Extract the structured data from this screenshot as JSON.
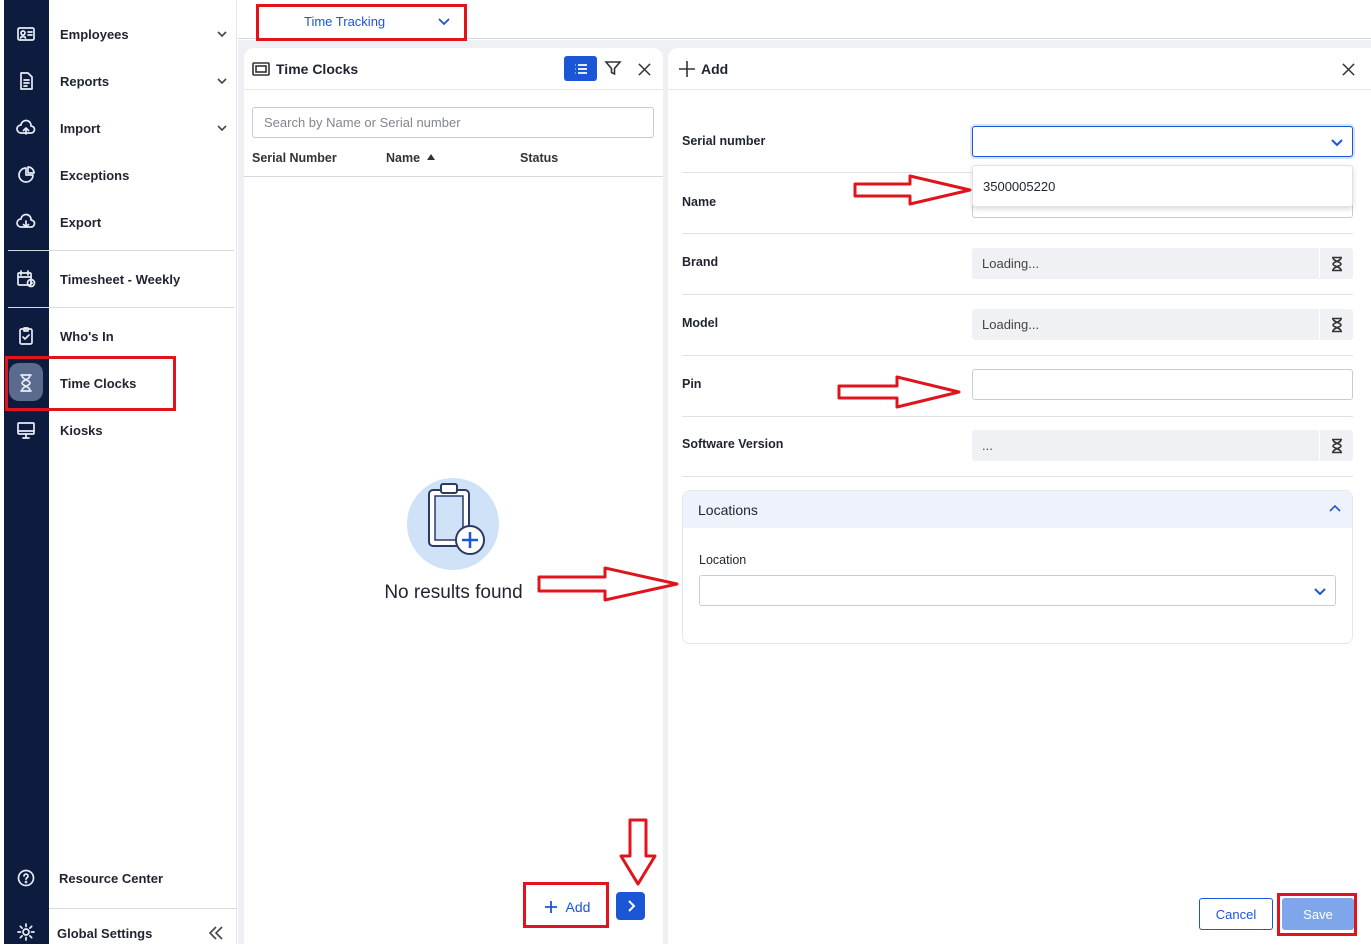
{
  "module": {
    "label": "Time Tracking"
  },
  "nav": {
    "items": [
      {
        "label": "Employees",
        "icon": "id-card-icon",
        "expandable": true
      },
      {
        "label": "Reports",
        "icon": "report-icon",
        "expandable": true
      },
      {
        "label": "Import",
        "icon": "cloud-upload-icon",
        "expandable": true
      },
      {
        "label": "Exceptions",
        "icon": "pie-chart-icon",
        "expandable": false
      },
      {
        "label": "Export",
        "icon": "cloud-download-icon",
        "expandable": false
      },
      {
        "label": "Timesheet - Weekly",
        "icon": "calendar-clock-icon",
        "expandable": false
      },
      {
        "label": "Who's In",
        "icon": "clipboard-check-icon",
        "expandable": false
      },
      {
        "label": "Time Clocks",
        "icon": "hourglass-icon",
        "expandable": false,
        "active": true
      },
      {
        "label": "Kiosks",
        "icon": "monitor-icon",
        "expandable": false
      }
    ],
    "resource_center": "Resource Center",
    "global_settings": "Global Settings"
  },
  "list_panel": {
    "title": "Time Clocks",
    "search_placeholder": "Search by Name or Serial number",
    "columns": [
      "Serial Number",
      "Name",
      "Status"
    ],
    "sorted_column": "Name",
    "empty_text": "No results found",
    "add_label": "Add"
  },
  "form_panel": {
    "title": "Add",
    "fields": {
      "serial_number": {
        "label": "Serial number",
        "value": ""
      },
      "name": {
        "label": "Name",
        "value": ""
      },
      "brand": {
        "label": "Brand",
        "value": "Loading..."
      },
      "model": {
        "label": "Model",
        "value": "Loading..."
      },
      "pin": {
        "label": "Pin",
        "value": ""
      },
      "software_version": {
        "label": "Software Version",
        "value": "..."
      }
    },
    "serial_options": [
      "3500005220"
    ],
    "locations": {
      "title": "Locations",
      "location_label": "Location",
      "location_value": ""
    },
    "cancel_label": "Cancel",
    "save_label": "Save"
  },
  "colors": {
    "accent": "#1a56d6",
    "rail": "#0d1b3e",
    "annotation": "#e0151c",
    "save_disabled": "#7fa6ea"
  }
}
